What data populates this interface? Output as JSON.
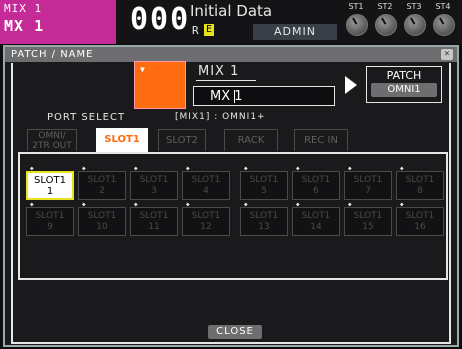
{
  "status": {
    "channel_line1": "MIX 1",
    "channel_line2": "MX 1",
    "scene_number": "000",
    "scene_title": "Initial Data",
    "r_flag": "R",
    "e_flag": "E",
    "user": "ADMIN",
    "st_labels": [
      "ST1",
      "ST2",
      "ST3",
      "ST4"
    ]
  },
  "window": {
    "title": "PATCH / NAME",
    "close_x": "×",
    "channel_name": "MIX 1",
    "name_value": "MX 1",
    "patch_label": "PATCH",
    "patch_value": "OMNI1",
    "port_select_label": "PORT SELECT",
    "port_info": "[MIX1] : OMNI1+",
    "tabs": [
      {
        "line1": "OMNI/",
        "line2": "2TR OUT",
        "selected": false
      },
      {
        "label": "SLOT1",
        "selected": true
      },
      {
        "label": "SLOT2",
        "selected": false
      },
      {
        "label": "RACK",
        "selected": false
      },
      {
        "label": "REC IN",
        "selected": false
      }
    ],
    "ports": [
      {
        "name": "SLOT1",
        "num": "1",
        "selected": true
      },
      {
        "name": "SLOT1",
        "num": "2",
        "selected": false
      },
      {
        "name": "SLOT1",
        "num": "3",
        "selected": false
      },
      {
        "name": "SLOT1",
        "num": "4",
        "selected": false
      },
      {
        "name": "SLOT1",
        "num": "5",
        "selected": false
      },
      {
        "name": "SLOT1",
        "num": "6",
        "selected": false
      },
      {
        "name": "SLOT1",
        "num": "7",
        "selected": false
      },
      {
        "name": "SLOT1",
        "num": "8",
        "selected": false
      },
      {
        "name": "SLOT1",
        "num": "9",
        "selected": false
      },
      {
        "name": "SLOT1",
        "num": "10",
        "selected": false
      },
      {
        "name": "SLOT1",
        "num": "11",
        "selected": false
      },
      {
        "name": "SLOT1",
        "num": "12",
        "selected": false
      },
      {
        "name": "SLOT1",
        "num": "13",
        "selected": false
      },
      {
        "name": "SLOT1",
        "num": "14",
        "selected": false
      },
      {
        "name": "SLOT1",
        "num": "15",
        "selected": false
      },
      {
        "name": "SLOT1",
        "num": "16",
        "selected": false
      }
    ],
    "close_button": "CLOSE"
  },
  "colors": {
    "channel_bg": "#c42b97",
    "swatch": "#ff6b10",
    "selected_outline": "#e6e21e",
    "selected_tab_text": "#ff6b10"
  }
}
